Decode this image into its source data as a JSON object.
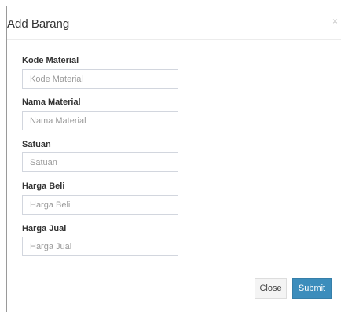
{
  "modal": {
    "title": "Add Barang",
    "close_icon": "×"
  },
  "form": {
    "fields": [
      {
        "label": "Kode Material",
        "placeholder": "Kode Material",
        "value": ""
      },
      {
        "label": "Nama Material",
        "placeholder": "Nama Material",
        "value": ""
      },
      {
        "label": "Satuan",
        "placeholder": "Satuan",
        "value": ""
      },
      {
        "label": "Harga Beli",
        "placeholder": "Harga Beli",
        "value": ""
      },
      {
        "label": "Harga Jual",
        "placeholder": "Harga Jual",
        "value": ""
      }
    ]
  },
  "footer": {
    "close_label": "Close",
    "submit_label": "Submit"
  },
  "colors": {
    "primary": "#3c8dbc",
    "default_button": "#f4f4f4"
  }
}
